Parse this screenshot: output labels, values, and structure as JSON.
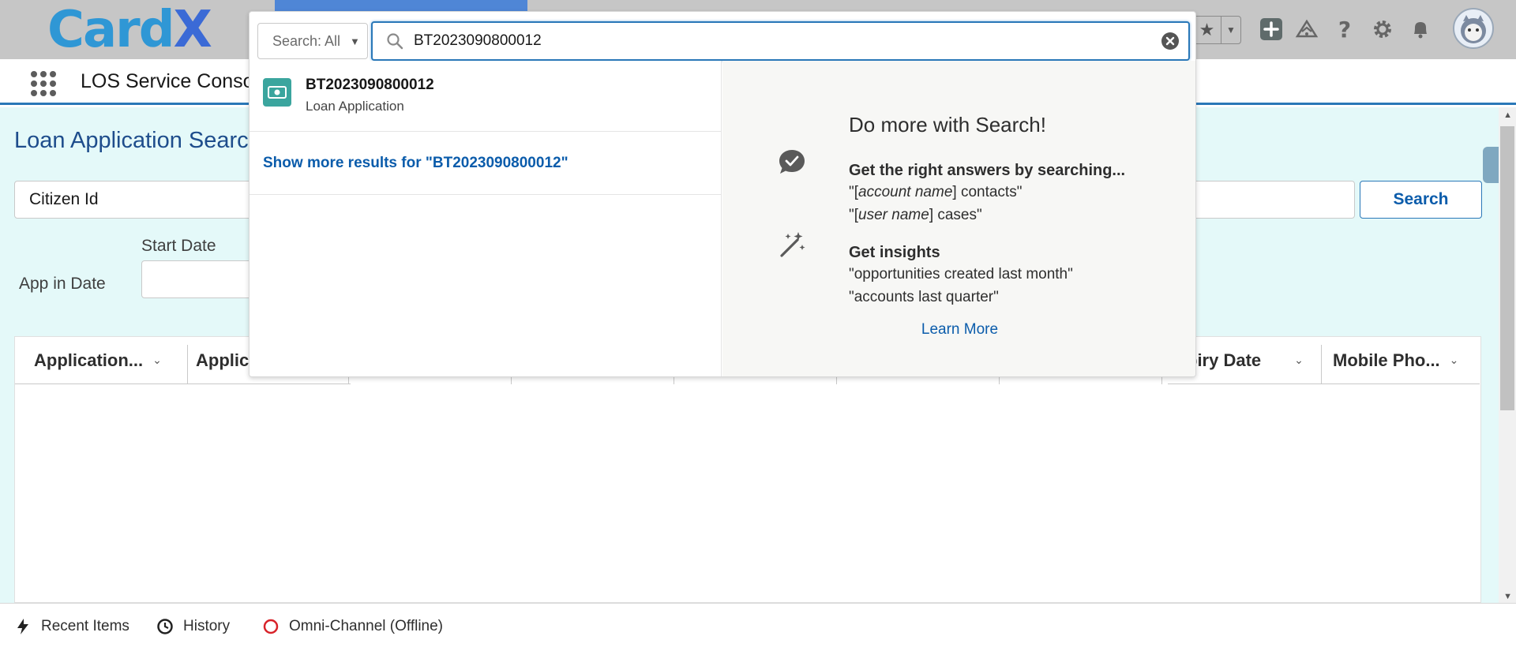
{
  "header": {
    "logo_text_a": "Card",
    "logo_text_b": "X"
  },
  "navbar": {
    "app_name": "LOS Service Console"
  },
  "page": {
    "title": "Loan Application Search",
    "citizen_field_value": "Citizen Id",
    "search_button": "Search",
    "app_in_date_label": "App in Date",
    "start_date_label": "Start Date"
  },
  "table": {
    "columns": [
      {
        "label": "Application..."
      },
      {
        "label": "Applic"
      },
      {
        "label": "piry Date"
      },
      {
        "label": "Mobile Pho..."
      }
    ]
  },
  "utility": {
    "recent_items": "Recent Items",
    "history": "History",
    "omni_channel": "Omni-Channel (Offline)"
  },
  "search": {
    "scope_label": "Search: All",
    "query": "BT2023090800012",
    "results": [
      {
        "title": "BT2023090800012",
        "subtitle": "Loan Application"
      }
    ],
    "show_more": "Show more results for \"BT2023090800012\"",
    "tips": {
      "heading": "Do more with Search!",
      "tip1_title": "Get the right answers by searching...",
      "tip1_line1_q1": "\"[",
      "tip1_line1_em": "account name",
      "tip1_line1_rest": "] contacts\"",
      "tip1_line2_q1": "\"[",
      "tip1_line2_em": "user name",
      "tip1_line2_rest": "] cases\"",
      "tip2_title": "Get insights",
      "tip2_line1": "\"opportunities created last month\"",
      "tip2_line2": "\"accounts last quarter\"",
      "learn_more": "Learn More"
    }
  },
  "colors": {
    "header_bg": "#c6c6c6",
    "accent_blue": "#0b5cab",
    "title_blue": "#1e4d8c",
    "main_bg": "#e4f9f9",
    "result_icon": "#3ba59e"
  }
}
